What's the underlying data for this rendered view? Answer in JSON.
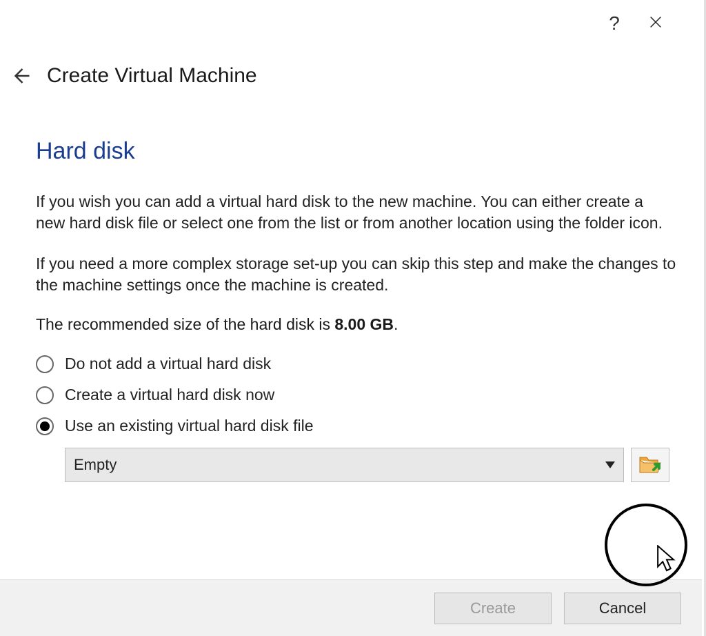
{
  "titlebar": {
    "help_label": "?",
    "close_label": "Close"
  },
  "header": {
    "page_title": "Create Virtual Machine"
  },
  "section": {
    "heading": "Hard disk",
    "paragraph1": "If you wish you can add a virtual hard disk to the new machine. You can either create a new hard disk file or select one from the list or from another location using the folder icon.",
    "paragraph2": "If you need a more complex storage set-up you can skip this step and make the changes to the machine settings once the machine is created.",
    "recommended_prefix": "The recommended size of the hard disk is ",
    "recommended_size": "8.00 GB",
    "recommended_suffix": "."
  },
  "options": {
    "opt1": "Do not add a virtual hard disk",
    "opt2": "Create a virtual hard disk now",
    "opt3": "Use an existing virtual hard disk file",
    "selected_index": 2
  },
  "combo": {
    "value": "Empty"
  },
  "buttons": {
    "create": "Create",
    "cancel": "Cancel"
  },
  "icons": {
    "back": "back-arrow-icon",
    "help": "help-icon",
    "close": "close-icon",
    "folder": "folder-open-icon",
    "dropdown": "chevron-down-icon",
    "cursor": "cursor-icon"
  }
}
